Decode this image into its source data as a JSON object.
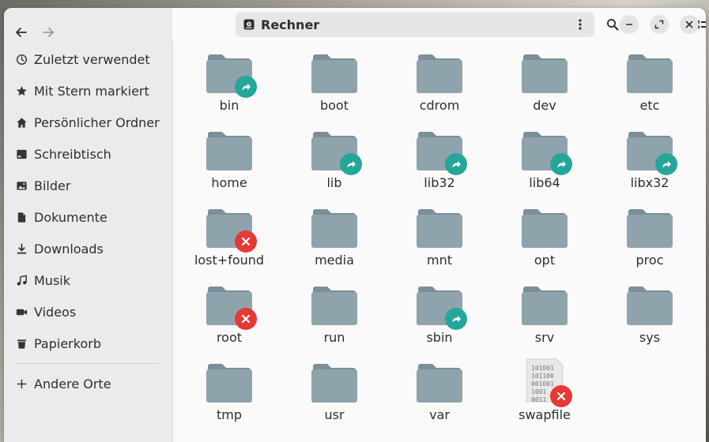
{
  "window": {
    "location_title": "Rechner"
  },
  "sidebar": {
    "items": [
      {
        "label": "Zuletzt verwendet",
        "icon": "clock-icon"
      },
      {
        "label": "Mit Stern markiert",
        "icon": "star-icon"
      },
      {
        "label": "Persönlicher Ordner",
        "icon": "home-icon"
      },
      {
        "label": "Schreibtisch",
        "icon": "desktop-icon"
      },
      {
        "label": "Bilder",
        "icon": "image-icon"
      },
      {
        "label": "Dokumente",
        "icon": "document-icon"
      },
      {
        "label": "Downloads",
        "icon": "download-icon"
      },
      {
        "label": "Musik",
        "icon": "music-icon"
      },
      {
        "label": "Videos",
        "icon": "video-icon"
      },
      {
        "label": "Papierkorb",
        "icon": "trash-icon"
      }
    ],
    "other": {
      "label": "Andere Orte",
      "icon": "plus-icon"
    }
  },
  "colors": {
    "folder": "#8fa3ad",
    "folder_tab": "#7a8f99",
    "link_emblem": "#26a69a",
    "denied_emblem": "#e53935"
  },
  "files": [
    {
      "name": "bin",
      "type": "folder",
      "emblem": "link"
    },
    {
      "name": "boot",
      "type": "folder",
      "emblem": ""
    },
    {
      "name": "cdrom",
      "type": "folder",
      "emblem": ""
    },
    {
      "name": "dev",
      "type": "folder",
      "emblem": ""
    },
    {
      "name": "etc",
      "type": "folder",
      "emblem": ""
    },
    {
      "name": "home",
      "type": "folder",
      "emblem": ""
    },
    {
      "name": "lib",
      "type": "folder",
      "emblem": "link"
    },
    {
      "name": "lib32",
      "type": "folder",
      "emblem": "link"
    },
    {
      "name": "lib64",
      "type": "folder",
      "emblem": "link"
    },
    {
      "name": "libx32",
      "type": "folder",
      "emblem": "link"
    },
    {
      "name": "lost+found",
      "type": "folder",
      "emblem": "denied"
    },
    {
      "name": "media",
      "type": "folder",
      "emblem": ""
    },
    {
      "name": "mnt",
      "type": "folder",
      "emblem": ""
    },
    {
      "name": "opt",
      "type": "folder",
      "emblem": ""
    },
    {
      "name": "proc",
      "type": "folder",
      "emblem": ""
    },
    {
      "name": "root",
      "type": "folder",
      "emblem": "denied"
    },
    {
      "name": "run",
      "type": "folder",
      "emblem": ""
    },
    {
      "name": "sbin",
      "type": "folder",
      "emblem": "link"
    },
    {
      "name": "srv",
      "type": "folder",
      "emblem": ""
    },
    {
      "name": "sys",
      "type": "folder",
      "emblem": ""
    },
    {
      "name": "tmp",
      "type": "folder",
      "emblem": ""
    },
    {
      "name": "usr",
      "type": "folder",
      "emblem": ""
    },
    {
      "name": "var",
      "type": "folder",
      "emblem": ""
    },
    {
      "name": "swapfile",
      "type": "binary",
      "emblem": "denied",
      "preview": [
        "101001",
        "101100",
        "001001",
        "1001",
        "0011"
      ]
    }
  ]
}
